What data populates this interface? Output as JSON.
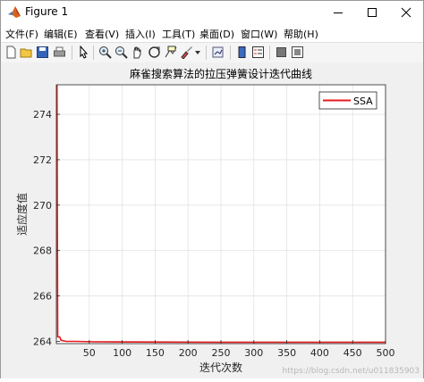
{
  "window": {
    "title": "Figure 1"
  },
  "menu": [
    "文件(F)",
    "编辑(E)",
    "查看(V)",
    "插入(I)",
    "工具(T)",
    "桌面(D)",
    "窗口(W)",
    "帮助(H)"
  ],
  "toolbar": {
    "icons": [
      "new-figure-icon",
      "open-file-icon",
      "save-icon",
      "print-icon",
      "edit-plot-icon",
      "zoom-in-icon",
      "zoom-out-icon",
      "pan-icon",
      "rotate-3d-icon",
      "data-cursor-icon",
      "brush-icon",
      "brush-dropdown-icon",
      "link-plot-icon",
      "colorbar-icon",
      "legend-icon",
      "hide-plot-tools-icon",
      "show-plot-tools-icon"
    ]
  },
  "chart_data": {
    "type": "line",
    "title": "麻雀搜索算法的拉压弹簧设计迭代曲线",
    "xlabel": "迭代次数",
    "ylabel": "适应度值",
    "xlim": [
      0,
      500
    ],
    "ylim": [
      263.9,
      275.3
    ],
    "xticks": [
      50,
      100,
      150,
      200,
      250,
      300,
      350,
      400,
      450,
      500
    ],
    "yticks": [
      264,
      266,
      268,
      270,
      272,
      274
    ],
    "grid": true,
    "legend_position": "top-right",
    "series": [
      {
        "name": "SSA",
        "color": "#e8191c",
        "points": [
          [
            1,
            275.3
          ],
          [
            2,
            264.2
          ],
          [
            5,
            264.2
          ],
          [
            7,
            264.05
          ],
          [
            15,
            264.0
          ],
          [
            30,
            264.0
          ],
          [
            60,
            263.98
          ],
          [
            120,
            263.97
          ],
          [
            250,
            263.96
          ],
          [
            400,
            263.96
          ],
          [
            500,
            263.96
          ]
        ]
      }
    ]
  },
  "watermark": "https://blog.csdn.net/u011835903"
}
